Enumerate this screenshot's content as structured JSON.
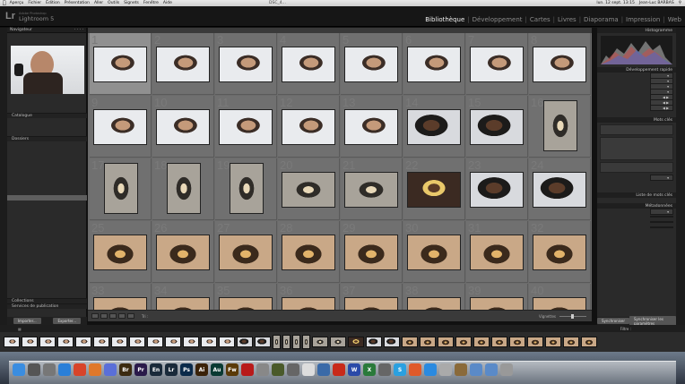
{
  "menubar": {
    "apple": "",
    "items": [
      "Aperçu",
      "Fichier",
      "Édition",
      "Présentation",
      "Aller",
      "Outils",
      "Signets",
      "Fenêtre",
      "Aide"
    ],
    "center": "DSC_4...",
    "clock": "lun. 12 sept. 13:15",
    "user": "Jean-Luc BARBAS"
  },
  "header": {
    "logo_mark": "Lr",
    "brand_small": "Adobe Photoshop",
    "brand": "Lightroom 5",
    "modules": [
      "Bibliothèque",
      "Développement",
      "Cartes",
      "Livres",
      "Diaporama",
      "Impression",
      "Web"
    ],
    "active_module": "Bibliothèque"
  },
  "left_panel": {
    "navigator_title": "Navigateur",
    "catalog_title": "Catalogue",
    "folders_title": "Dossiers",
    "folders": [
      {
        "name": "",
        "count": ""
      },
      {
        "name": "",
        "count": ""
      },
      {
        "name": "",
        "count": ""
      },
      {
        "name": "",
        "count": ""
      },
      {
        "name": "",
        "count": ""
      },
      {
        "name": "",
        "count": ""
      },
      {
        "name": "",
        "count": ""
      },
      {
        "name": "",
        "count": ""
      },
      {
        "name": "",
        "count": ""
      },
      {
        "name": "",
        "count": ""
      },
      {
        "name": "",
        "count": ""
      },
      {
        "name": "",
        "count": ""
      },
      {
        "name": "",
        "count": ""
      },
      {
        "name": "",
        "count": ""
      },
      {
        "name": "",
        "count": ""
      },
      {
        "name": "",
        "count": ""
      },
      {
        "name": "",
        "count": ""
      },
      {
        "name": "",
        "count": ""
      },
      {
        "name": "",
        "count": ""
      },
      {
        "name": "",
        "count": ""
      },
      {
        "name": "",
        "count": ""
      },
      {
        "name": "",
        "count": ""
      },
      {
        "name": "",
        "count": ""
      },
      {
        "name": "",
        "count": ""
      },
      {
        "name": "",
        "count": ""
      },
      {
        "name": "",
        "count": ""
      },
      {
        "name": "",
        "count": ""
      }
    ],
    "selected_folder_index": 10,
    "collections_title": "Collections",
    "publish_title": "Services de publication",
    "import_label": "Importer...",
    "export_label": "Exporter..."
  },
  "grid": {
    "cells": [
      {
        "num": "1",
        "type": "land",
        "style": "th-white",
        "selected": true
      },
      {
        "num": "2",
        "type": "land",
        "style": "th-white"
      },
      {
        "num": "3",
        "type": "land",
        "style": "th-white"
      },
      {
        "num": "4",
        "type": "land",
        "style": "th-white"
      },
      {
        "num": "5",
        "type": "land",
        "style": "th-white"
      },
      {
        "num": "6",
        "type": "land",
        "style": "th-white"
      },
      {
        "num": "7",
        "type": "land",
        "style": "th-white"
      },
      {
        "num": "8",
        "type": "land",
        "style": "th-white"
      },
      {
        "num": "9",
        "type": "land",
        "style": "th-white"
      },
      {
        "num": "10",
        "type": "land",
        "style": "th-white"
      },
      {
        "num": "11",
        "type": "land",
        "style": "th-white"
      },
      {
        "num": "12",
        "type": "land",
        "style": "th-white"
      },
      {
        "num": "13",
        "type": "land",
        "style": "th-white"
      },
      {
        "num": "14",
        "type": "land",
        "style": "th-dark"
      },
      {
        "num": "15",
        "type": "land",
        "style": "th-dark"
      },
      {
        "num": "16",
        "type": "port",
        "style": "th-stage"
      },
      {
        "num": "17",
        "type": "port",
        "style": "th-stage"
      },
      {
        "num": "18",
        "type": "port",
        "style": "th-stage"
      },
      {
        "num": "19",
        "type": "port",
        "style": "th-stage"
      },
      {
        "num": "20",
        "type": "land",
        "style": "th-stage"
      },
      {
        "num": "21",
        "type": "land",
        "style": "th-stage"
      },
      {
        "num": "22",
        "type": "land",
        "style": "th-girl"
      },
      {
        "num": "23",
        "type": "land",
        "style": "th-dark"
      },
      {
        "num": "24",
        "type": "land",
        "style": "th-dark"
      },
      {
        "num": "25",
        "type": "land",
        "style": "th-warm"
      },
      {
        "num": "26",
        "type": "land",
        "style": "th-warm"
      },
      {
        "num": "27",
        "type": "land",
        "style": "th-warm"
      },
      {
        "num": "28",
        "type": "land",
        "style": "th-warm"
      },
      {
        "num": "29",
        "type": "land",
        "style": "th-warm"
      },
      {
        "num": "30",
        "type": "land",
        "style": "th-warm"
      },
      {
        "num": "31",
        "type": "land",
        "style": "th-warm"
      },
      {
        "num": "32",
        "type": "land",
        "style": "th-warm"
      },
      {
        "num": "33",
        "type": "land",
        "style": "th-warm"
      },
      {
        "num": "34",
        "type": "land",
        "style": "th-warm"
      },
      {
        "num": "35",
        "type": "land",
        "style": "th-warm"
      },
      {
        "num": "36",
        "type": "land",
        "style": "th-warm"
      },
      {
        "num": "37",
        "type": "land",
        "style": "th-warm"
      },
      {
        "num": "38",
        "type": "land",
        "style": "th-warm"
      },
      {
        "num": "39",
        "type": "land",
        "style": "th-warm"
      },
      {
        "num": "40",
        "type": "land",
        "style": "th-warm"
      }
    ],
    "toolbar_sort": "Tri :",
    "thumbnails_label": "Vignettes"
  },
  "right_panel": {
    "histogram_title": "Histogramme",
    "quick_develop_title": "Développement rapide",
    "keywords_title": "Mots clés",
    "keyword_list_title": "Liste de mots clés",
    "metadata_title": "Métadonnées",
    "sync_label": "Synchroniser",
    "sync_settings_label": "Synchroniser les paramètres"
  },
  "filmstrip": {
    "info": "",
    "filter_label": "Filtre :"
  },
  "dock": {
    "icons": [
      {
        "name": "finder-icon",
        "label": "",
        "color": "#3a8de0"
      },
      {
        "name": "launchpad-icon",
        "label": "",
        "color": "#555"
      },
      {
        "name": "system-prefs-icon",
        "label": "",
        "color": "#777"
      },
      {
        "name": "safari-icon",
        "label": "",
        "color": "#2a7fd8"
      },
      {
        "name": "chrome-icon",
        "label": "",
        "color": "#d8442a"
      },
      {
        "name": "firefox-icon",
        "label": "",
        "color": "#e0782a"
      },
      {
        "name": "itunes-icon",
        "label": "",
        "color": "#5a6fd8"
      },
      {
        "name": "bridge-icon",
        "label": "Br",
        "color": "#3b2a10"
      },
      {
        "name": "premiere-icon",
        "label": "Pr",
        "color": "#2a1a4a"
      },
      {
        "name": "encore-icon",
        "label": "En",
        "color": "#1a2a3a"
      },
      {
        "name": "lightroom-icon",
        "label": "Lr",
        "color": "#1a2a3a"
      },
      {
        "name": "photoshop-icon",
        "label": "Ps",
        "color": "#0a2a4a"
      },
      {
        "name": "illustrator-icon",
        "label": "Ai",
        "color": "#3a2208"
      },
      {
        "name": "audition-icon",
        "label": "Au",
        "color": "#0a3a32"
      },
      {
        "name": "fireworks-icon",
        "label": "Fw",
        "color": "#5a3a08"
      },
      {
        "name": "acrobat-icon",
        "label": "",
        "color": "#b81a1a"
      },
      {
        "name": "photos-icon",
        "label": "",
        "color": "#888"
      },
      {
        "name": "app-icon",
        "label": "",
        "color": "#4a5a2a"
      },
      {
        "name": "preview-icon",
        "label": "",
        "color": "#666"
      },
      {
        "name": "calendar-icon",
        "label": "",
        "color": "#ddd"
      },
      {
        "name": "app-icon",
        "label": "",
        "color": "#3a6aa8"
      },
      {
        "name": "ftp-icon",
        "label": "",
        "color": "#c82a1a"
      },
      {
        "name": "word-icon",
        "label": "W",
        "color": "#2a4aa8"
      },
      {
        "name": "excel-icon",
        "label": "X",
        "color": "#2a7a3a"
      },
      {
        "name": "app-icon",
        "label": "",
        "color": "#666"
      },
      {
        "name": "skype-icon",
        "label": "S",
        "color": "#2aa0e0"
      },
      {
        "name": "app-icon",
        "label": "",
        "color": "#e05a2a"
      },
      {
        "name": "app-icon",
        "label": "",
        "color": "#2a8ae0"
      },
      {
        "name": "app-icon",
        "label": "",
        "color": "#aaa"
      },
      {
        "name": "app-icon",
        "label": "",
        "color": "#8a6a3a"
      },
      {
        "name": "folder-icon",
        "label": "",
        "color": "#5a8ac8"
      },
      {
        "name": "folder-icon",
        "label": "",
        "color": "#5a8ac8"
      },
      {
        "name": "trash-icon",
        "label": "",
        "color": "#999"
      }
    ]
  }
}
